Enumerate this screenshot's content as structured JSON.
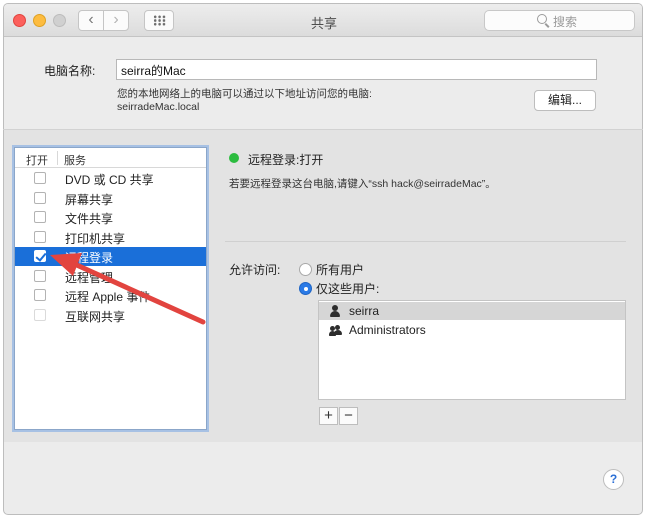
{
  "window": {
    "title": "共享"
  },
  "toolbar": {
    "back": "‹",
    "forward": "›",
    "search_placeholder": "搜索"
  },
  "computer_name": {
    "label": "电脑名称:",
    "value": "seirra的Mac",
    "description_line1": "您的本地网络上的电脑可以通过以下地址访问您的电脑:",
    "description_line2": "seirradeMac.local",
    "edit_button": "编辑..."
  },
  "services": {
    "header_open": "打开",
    "header_service": "服务",
    "items": [
      {
        "label": "DVD 或 CD 共享",
        "checked": false,
        "selected": false
      },
      {
        "label": "屏幕共享",
        "checked": false,
        "selected": false
      },
      {
        "label": "文件共享",
        "checked": false,
        "selected": false
      },
      {
        "label": "打印机共享",
        "checked": false,
        "selected": false
      },
      {
        "label": "远程登录",
        "checked": true,
        "selected": true
      },
      {
        "label": "远程管理",
        "checked": false,
        "selected": false
      },
      {
        "label": "远程 Apple 事件",
        "checked": false,
        "selected": false
      },
      {
        "label": "互联网共享",
        "checked": false,
        "selected": false
      }
    ]
  },
  "detail": {
    "status": "远程登录:打开",
    "status_color": "#2cbc3f",
    "hint": "若要远程登录这台电脑,请键入“ssh hack@seirradeMac”。",
    "access_label": "允许访问:",
    "option_all": "所有用户",
    "option_some": "仅这些用户:",
    "selected_option": "option_some",
    "users": [
      {
        "name": "seirra",
        "icon": "user-icon"
      },
      {
        "name": "Administrators",
        "icon": "group-icon"
      }
    ],
    "add_button": "+",
    "remove_button": "−"
  },
  "help": "?",
  "colors": {
    "selection": "#1a6fd9",
    "annotation_arrow": "#e2443f"
  }
}
